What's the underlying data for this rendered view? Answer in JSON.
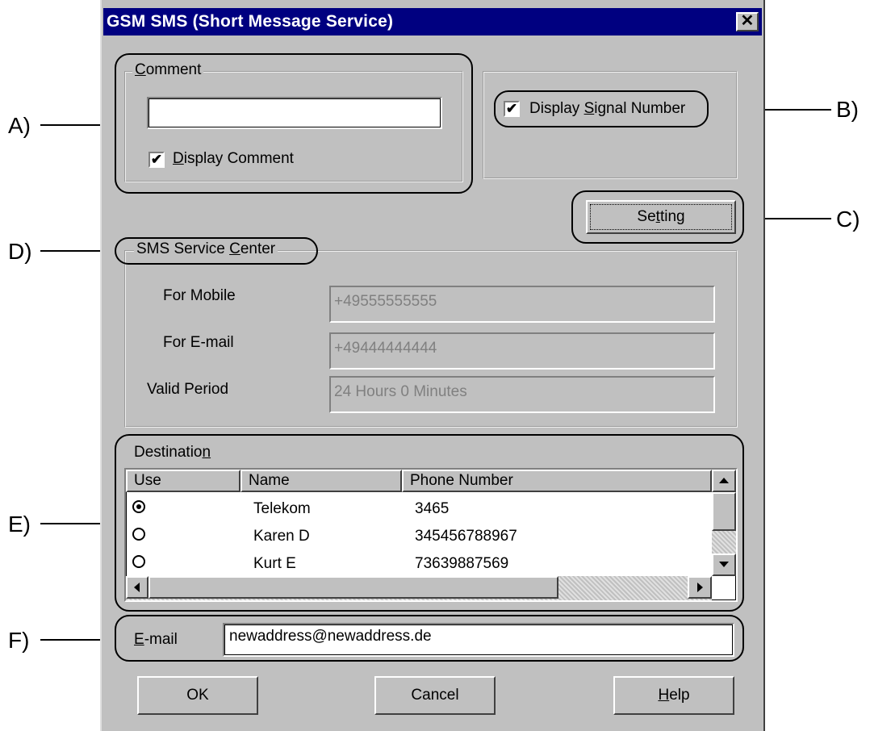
{
  "window": {
    "title": "GSM SMS (Short Message Service)",
    "close_glyph": "✕"
  },
  "comment_group": {
    "legend_prefix": "",
    "legend_u": "C",
    "legend_rest": "omment",
    "value": "",
    "display_checked": true,
    "display_label_u": "D",
    "display_label_rest": "isplay Comment"
  },
  "signal_group": {
    "checked": true,
    "label_pre": "Display ",
    "label_u": "S",
    "label_rest": "ignal Number"
  },
  "setting_button": {
    "pre": "Se",
    "u": "t",
    "rest": "ting"
  },
  "service_center": {
    "legend_pre": "SMS Service ",
    "legend_u": "C",
    "legend_rest": "enter",
    "mobile_label": "For Mobile",
    "mobile_value": "+49555555555",
    "email_label": "For E-mail",
    "email_value": "+49444444444",
    "valid_label": "Valid Period",
    "valid_value": "24 Hours 0 Minutes"
  },
  "destination": {
    "legend_pre": "Destinatio",
    "legend_u": "n",
    "legend_rest": "",
    "columns": [
      "Use",
      "Name",
      "Phone Number"
    ],
    "rows": [
      {
        "selected": true,
        "name": "Telekom",
        "phone": "3465"
      },
      {
        "selected": false,
        "name": "Karen D",
        "phone": "345456788967"
      },
      {
        "selected": false,
        "name": "Kurt E",
        "phone": "73639887569"
      }
    ]
  },
  "email_row": {
    "label_u": "E",
    "label_rest": "-mail",
    "value": "newaddress@newaddress.de"
  },
  "buttons": {
    "ok": "OK",
    "cancel": "Cancel",
    "help_u": "H",
    "help_rest": "elp"
  },
  "annotations": {
    "a": "A)",
    "b": "B)",
    "c": "C)",
    "d": "D)",
    "e": "E)",
    "f": "F)"
  }
}
